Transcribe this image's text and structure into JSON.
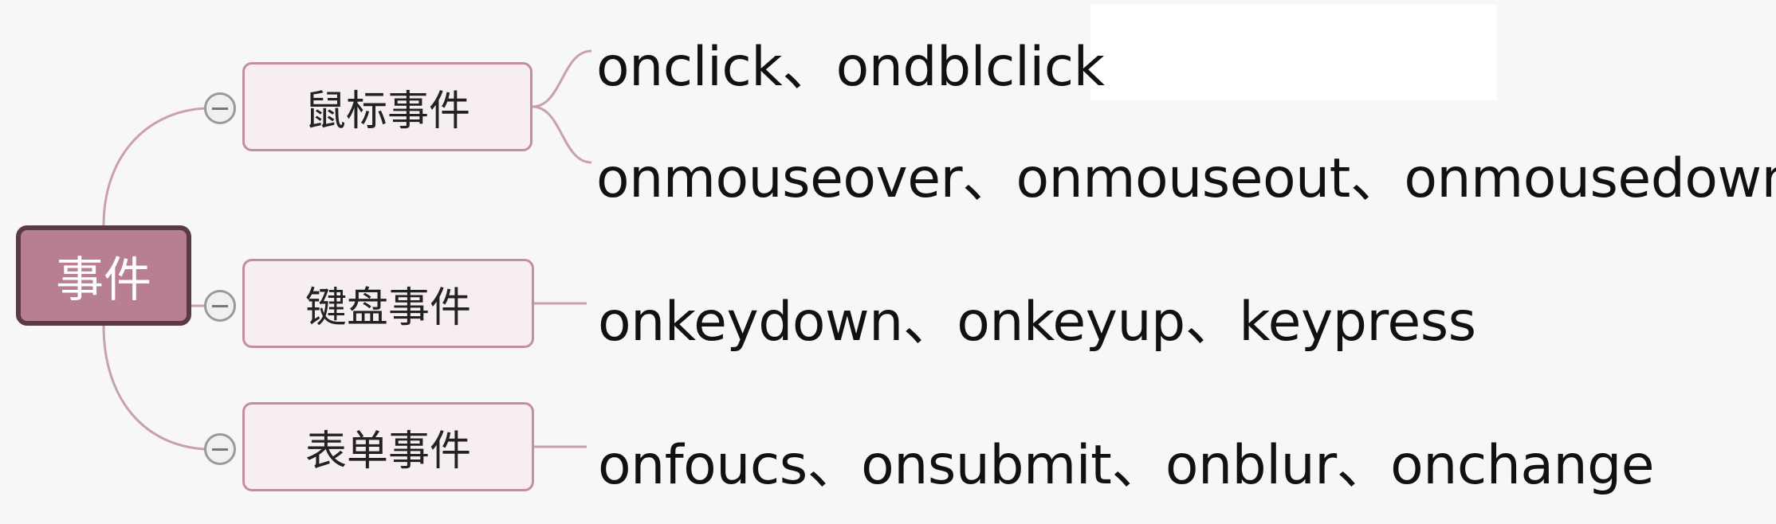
{
  "root": {
    "label": "事件"
  },
  "branches": [
    {
      "label": "鼠标事件",
      "leaves": [
        "onclick、ondblclick",
        "onmouseover、onmouseout、onmousedown、"
      ]
    },
    {
      "label": "键盘事件",
      "leaves": [
        "onkeydown、onkeyup、keypress"
      ]
    },
    {
      "label": "表单事件",
      "leaves": [
        "onfoucs、onsubmit、onblur、onchange"
      ]
    }
  ],
  "colors": {
    "root_fill": "#b87f93",
    "root_border": "#5a3a46",
    "branch_border": "#c48ea1",
    "branch_fill": "#f7eef2",
    "connector": "#c9a0ae"
  }
}
